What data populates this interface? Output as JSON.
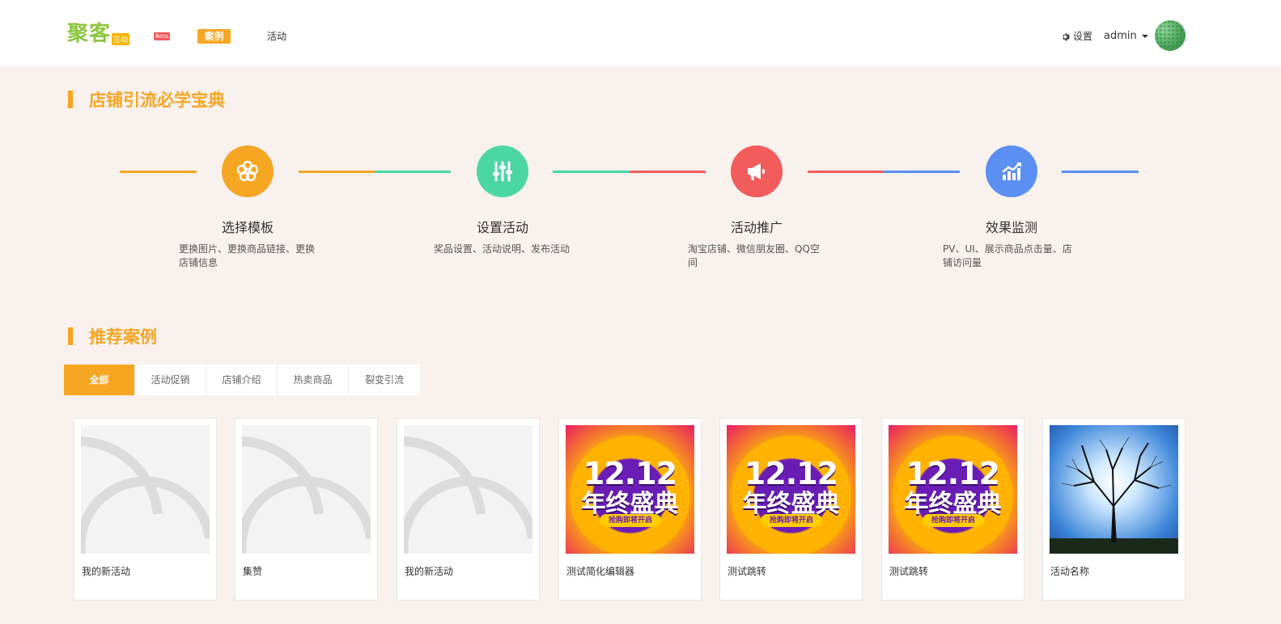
{
  "header": {
    "logo": "聚客",
    "logo_badge": "互动",
    "beta": "Beta",
    "nav": [
      "案例",
      "活动"
    ],
    "settings": "设置",
    "user": "admin"
  },
  "guide": {
    "title": "店铺引流必学宝典",
    "steps": [
      {
        "title": "选择模板",
        "desc": "更换图片、更换商品链接、更换店铺信息",
        "color": "#f5a623",
        "icon": "flower-icon"
      },
      {
        "title": "设置活动",
        "desc": "奖品设置、活动说明、发布活动",
        "color": "#4cd6a5",
        "icon": "sliders-icon"
      },
      {
        "title": "活动推广",
        "desc": "淘宝店铺、微信朋友圈、QQ空间",
        "color": "#f25c5c",
        "icon": "megaphone-icon"
      },
      {
        "title": "效果监测",
        "desc": "PV、UI、展示商品点击量、店铺访问量",
        "color": "#5b8ff2",
        "icon": "chart-icon"
      }
    ]
  },
  "cases": {
    "title": "推荐案例",
    "tabs": [
      "全部",
      "活动促销",
      "店铺介绍",
      "热卖商品",
      "裂变引流"
    ],
    "items": [
      {
        "name": "我的新活动",
        "thumb": "placeholder"
      },
      {
        "name": "集赞",
        "thumb": "placeholder"
      },
      {
        "name": "我的新活动",
        "thumb": "placeholder"
      },
      {
        "name": "测试简化编辑器",
        "thumb": "promo"
      },
      {
        "name": "测试跳转",
        "thumb": "promo"
      },
      {
        "name": "测试跳转",
        "thumb": "promo"
      },
      {
        "name": "活动名称",
        "thumb": "tree"
      }
    ],
    "promo_big": "12.12",
    "promo_sub": "年终盛典",
    "promo_pill": "抢购即将开启"
  }
}
